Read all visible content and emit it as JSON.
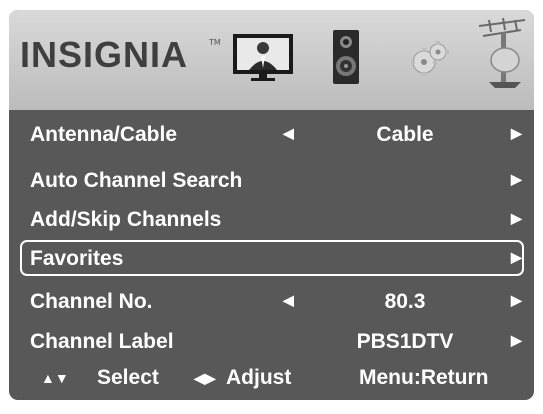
{
  "brand": {
    "name": "INSIGNIA",
    "tm": "TM"
  },
  "menu_tabs": [
    {
      "icon": "tv-picture-icon"
    },
    {
      "icon": "speaker-icon"
    },
    {
      "icon": "settings-gear-icon"
    },
    {
      "icon": "antenna-channel-icon"
    }
  ],
  "rows": [
    {
      "label": "Antenna/Cable",
      "value": "Cable",
      "has_left_arrow": true
    },
    {
      "label": "Auto Channel Search",
      "value": "",
      "has_left_arrow": false
    },
    {
      "label": "Add/Skip Channels",
      "value": "",
      "has_left_arrow": false
    },
    {
      "label": "Favorites",
      "value": "",
      "has_left_arrow": false,
      "selected": true
    },
    {
      "label": "Channel No.",
      "value": "80.3",
      "has_left_arrow": true
    },
    {
      "label": "Channel Label",
      "value": "PBS1DTV",
      "has_left_arrow": false
    }
  ],
  "glyphs": {
    "left": "◀",
    "right": "▶",
    "updown": "▲▼",
    "leftright": "◀▶"
  },
  "footer": {
    "select": "Select",
    "adjust": "Adjust",
    "menu_return": "Menu:Return"
  },
  "colors": {
    "panel": "#585858",
    "topbar": "#cccccc",
    "text": "#ffffff"
  }
}
